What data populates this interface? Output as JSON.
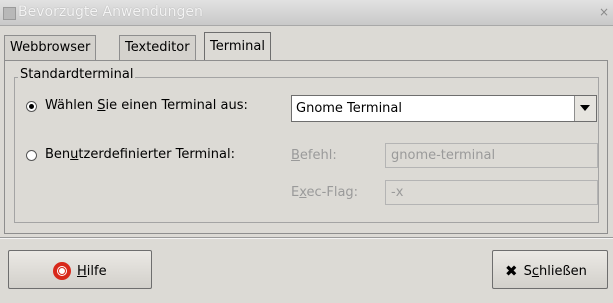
{
  "window": {
    "title": "Bevorzugte Anwendungen",
    "close_label": "×"
  },
  "tabs": [
    {
      "label": "Webbrowser",
      "active": false
    },
    {
      "label": "Texteditor",
      "active": false
    },
    {
      "label": "Terminal",
      "active": true
    }
  ],
  "section": {
    "title": "Standardterminal",
    "option_select": {
      "label_pre": "Wählen ",
      "label_mn": "S",
      "label_post": "ie einen Terminal aus:",
      "checked": true,
      "combo_value": "Gnome Terminal"
    },
    "option_custom": {
      "label_pre": "Ben",
      "label_mn": "u",
      "label_post": "tzerdefinierter Terminal:",
      "checked": false,
      "command_label_mn": "B",
      "command_label_post": "efehl:",
      "command_value": "gnome-terminal",
      "exec_label_pre": "E",
      "exec_label_mn": "x",
      "exec_label_post": "ec-Flag:",
      "exec_value": "-x"
    }
  },
  "buttons": {
    "help_mn": "H",
    "help_post": "ilfe",
    "close_pre": "S",
    "close_mn": "c",
    "close_post": "hließen"
  }
}
